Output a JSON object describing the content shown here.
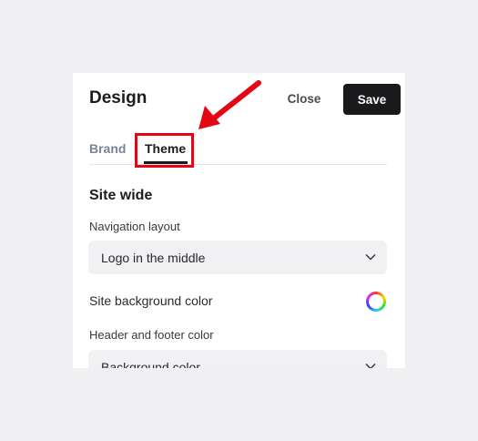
{
  "header": {
    "title": "Design",
    "close_label": "Close",
    "save_label": "Save"
  },
  "tabs": [
    {
      "label": "Brand",
      "active": false
    },
    {
      "label": "Theme",
      "active": true
    }
  ],
  "section": {
    "title": "Site wide",
    "navigation_layout": {
      "label": "Navigation layout",
      "value": "Logo in the middle"
    },
    "site_background": {
      "label": "Site background color",
      "icon": "color-wheel-icon"
    },
    "header_footer": {
      "label": "Header and footer color",
      "value": "Background color"
    }
  },
  "annotation": {
    "color": "#e30613"
  },
  "colors": {
    "page_bg": "#f0f0f2",
    "panel_bg": "#ffffff",
    "primary_button": "#1a1a1c",
    "inactive_tab": "#7a8599",
    "select_bg": "#f1f1f3"
  }
}
